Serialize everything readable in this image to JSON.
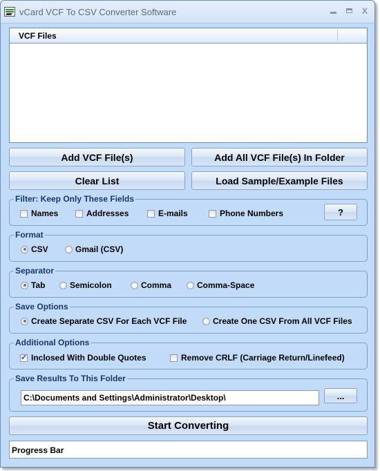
{
  "window": {
    "title": "vCard VCF To CSV Converter Software",
    "app_icon": "vcard-converter-icon",
    "controls": {
      "minimize": "minimize-icon",
      "maximize": "maximize-icon",
      "close_glyph": "X"
    }
  },
  "file_list": {
    "column_header": "VCF Files",
    "items": []
  },
  "buttons": {
    "add_files": "Add VCF File(s)",
    "add_folder": "Add All VCF File(s) In Folder",
    "clear_list": "Clear List",
    "load_samples": "Load Sample/Example Files",
    "help": "?",
    "browse": "...",
    "start": "Start Converting"
  },
  "filter": {
    "label": "Filter: Keep Only These Fields",
    "options": [
      {
        "label": "Names",
        "checked": false
      },
      {
        "label": "Addresses",
        "checked": false
      },
      {
        "label": "E-mails",
        "checked": false
      },
      {
        "label": "Phone Numbers",
        "checked": false
      }
    ]
  },
  "format": {
    "label": "Format",
    "options": [
      {
        "label": "CSV",
        "selected": true
      },
      {
        "label": "Gmail (CSV)",
        "selected": false
      }
    ]
  },
  "separator": {
    "label": "Separator",
    "options": [
      {
        "label": "Tab",
        "selected": true
      },
      {
        "label": "Semicolon",
        "selected": false
      },
      {
        "label": "Comma",
        "selected": false
      },
      {
        "label": "Comma-Space",
        "selected": false
      }
    ]
  },
  "save_options": {
    "label": "Save Options",
    "options": [
      {
        "label": "Create Separate CSV For Each VCF File",
        "selected": true
      },
      {
        "label": "Create One CSV From All VCF Files",
        "selected": false
      }
    ]
  },
  "additional_options": {
    "label": "Additional Options",
    "options": [
      {
        "label": "Inclosed With Double Quotes",
        "checked": true
      },
      {
        "label": "Remove CRLF (Carriage Return/Linefeed)",
        "checked": false
      }
    ]
  },
  "save_folder": {
    "label": "Save Results To This Folder",
    "value": "C:\\Documents and Settings\\Administrator\\Desktop\\"
  },
  "progress": {
    "label": "Progress Bar",
    "value": 0
  }
}
